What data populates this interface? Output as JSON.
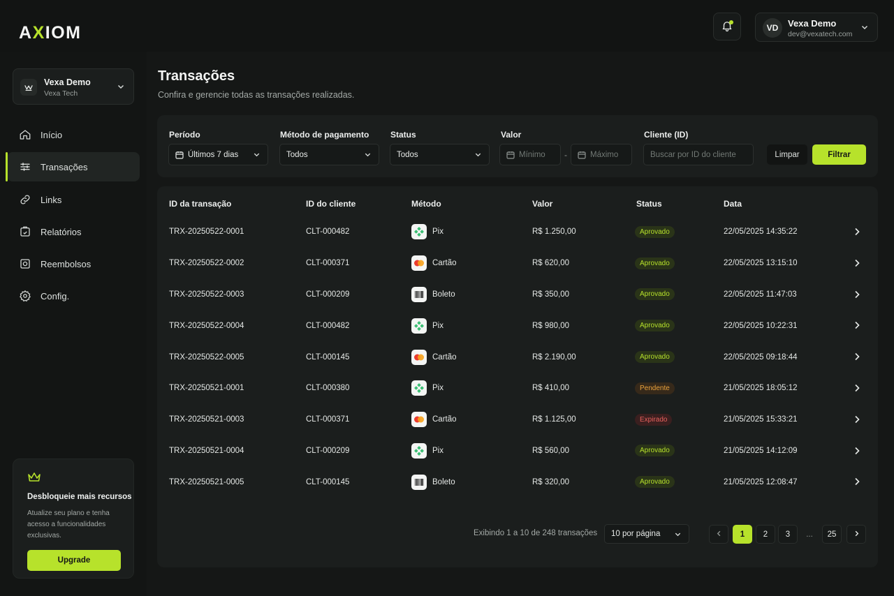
{
  "brand": {
    "logo_pre": "A",
    "logo_x": "X",
    "logo_post": "IOM"
  },
  "user": {
    "initials": "VD",
    "name": "Vexa Demo",
    "email": "dev@vexatech.com"
  },
  "org": {
    "name": "Vexa Demo",
    "sub": "Vexa Tech"
  },
  "nav": [
    {
      "label": "Início",
      "icon": "home-icon",
      "active": false
    },
    {
      "label": "Transações",
      "icon": "transfer-icon",
      "active": true
    },
    {
      "label": "Links",
      "icon": "link-icon",
      "active": false
    },
    {
      "label": "Relatórios",
      "icon": "report-icon",
      "active": false
    },
    {
      "label": "Reembolsos",
      "icon": "refund-icon",
      "active": false
    },
    {
      "label": "Config.",
      "icon": "gear-icon",
      "active": false
    }
  ],
  "promo": {
    "title": "Desbloqueie mais recursos",
    "text": "Atualize seu plano e tenha acesso a funcionalidades exclusivas.",
    "button": "Upgrade"
  },
  "page": {
    "title": "Transações",
    "subtitle": "Confira e gerencie todas as transações realizadas."
  },
  "filters": {
    "period_label": "Período",
    "period_value": "Últimos 7 dias",
    "method_label": "Método de pagamento",
    "method_value": "Todos",
    "status_label": "Status",
    "status_value": "Todos",
    "value_label": "Valor",
    "min_placeholder": "Mínimo",
    "max_placeholder": "Máximo",
    "client_label": "Cliente (ID)",
    "client_placeholder": "Buscar por ID do cliente",
    "clear": "Limpar",
    "filter": "Filtrar"
  },
  "table": {
    "headers": [
      "ID da transação",
      "ID do cliente",
      "Método",
      "Valor",
      "Status",
      "Data"
    ],
    "rows": [
      {
        "id": "TRX-20250522-0001",
        "client": "CLT-000482",
        "method": "Pix",
        "value": "R$ 1.250,00",
        "status": "Aprovado",
        "status_type": "ok",
        "date": "22/05/2025 14:35:22"
      },
      {
        "id": "TRX-20250522-0002",
        "client": "CLT-000371",
        "method": "Cartão",
        "value": "R$ 620,00",
        "status": "Aprovado",
        "status_type": "ok",
        "date": "22/05/2025 13:15:10"
      },
      {
        "id": "TRX-20250522-0003",
        "client": "CLT-000209",
        "method": "Boleto",
        "value": "R$ 350,00",
        "status": "Aprovado",
        "status_type": "ok",
        "date": "22/05/2025 11:47:03"
      },
      {
        "id": "TRX-20250522-0004",
        "client": "CLT-000482",
        "method": "Pix",
        "value": "R$ 980,00",
        "status": "Aprovado",
        "status_type": "ok",
        "date": "22/05/2025 10:22:31"
      },
      {
        "id": "TRX-20250522-0005",
        "client": "CLT-000145",
        "method": "Cartão",
        "value": "R$ 2.190,00",
        "status": "Aprovado",
        "status_type": "ok",
        "date": "22/05/2025 09:18:44"
      },
      {
        "id": "TRX-20250521-0001",
        "client": "CLT-000380",
        "method": "Pix",
        "value": "R$ 410,00",
        "status": "Pendente",
        "status_type": "pend",
        "date": "21/05/2025 18:05:12"
      },
      {
        "id": "TRX-20250521-0003",
        "client": "CLT-000371",
        "method": "Cartão",
        "value": "R$ 1.125,00",
        "status": "Expirado",
        "status_type": "exp",
        "date": "21/05/2025 15:33:21"
      },
      {
        "id": "TRX-20250521-0004",
        "client": "CLT-000209",
        "method": "Pix",
        "value": "R$ 560,00",
        "status": "Aprovado",
        "status_type": "ok",
        "date": "21/05/2025 14:12:09"
      },
      {
        "id": "TRX-20250521-0005",
        "client": "CLT-000145",
        "method": "Boleto",
        "value": "R$ 320,00",
        "status": "Aprovado",
        "status_type": "ok",
        "date": "21/05/2025 12:08:47"
      }
    ]
  },
  "pagination": {
    "info": "Exibindo 1 a 10 de 248 transações",
    "per_page": "10 por página",
    "pages": [
      "1",
      "2",
      "3",
      "...",
      "25"
    ],
    "current": "1"
  },
  "colors": {
    "accent": "#b7e22b",
    "pending": "#e9a13b",
    "expired": "#e8615d"
  }
}
